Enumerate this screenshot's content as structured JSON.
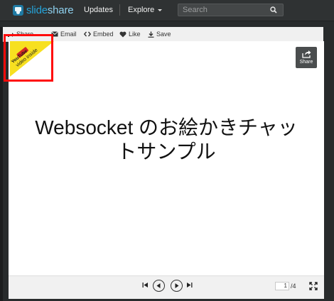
{
  "header": {
    "logo_part1": "slide",
    "logo_part2": "share",
    "nav_updates": "Updates",
    "nav_explore": "Explore",
    "search_placeholder": "Search"
  },
  "actions": {
    "share": "Share",
    "email": "Email",
    "embed": "Embed",
    "like": "Like",
    "save": "Save"
  },
  "badge": {
    "youtube": "YouTube",
    "video_inside": "video inside"
  },
  "floating_share_label": "Share",
  "slide": {
    "line1": "Websocket のお絵かきチャッ",
    "line2": "トサンプル"
  },
  "pagination": {
    "current_page": "1",
    "total_label": "/4"
  },
  "colors": {
    "logo_blue": "#25a3d8",
    "highlight_red": "#ff0a0a",
    "badge_yellow": "#f7e020",
    "youtube_red": "#d42a22"
  },
  "icons": [
    "slideshare-logo-icon",
    "caret-down-icon",
    "search-icon",
    "share-icon",
    "email-icon",
    "embed-icon",
    "like-icon",
    "save-icon",
    "first-page-icon",
    "previous-icon",
    "next-icon",
    "last-page-icon",
    "fullscreen-icon"
  ]
}
